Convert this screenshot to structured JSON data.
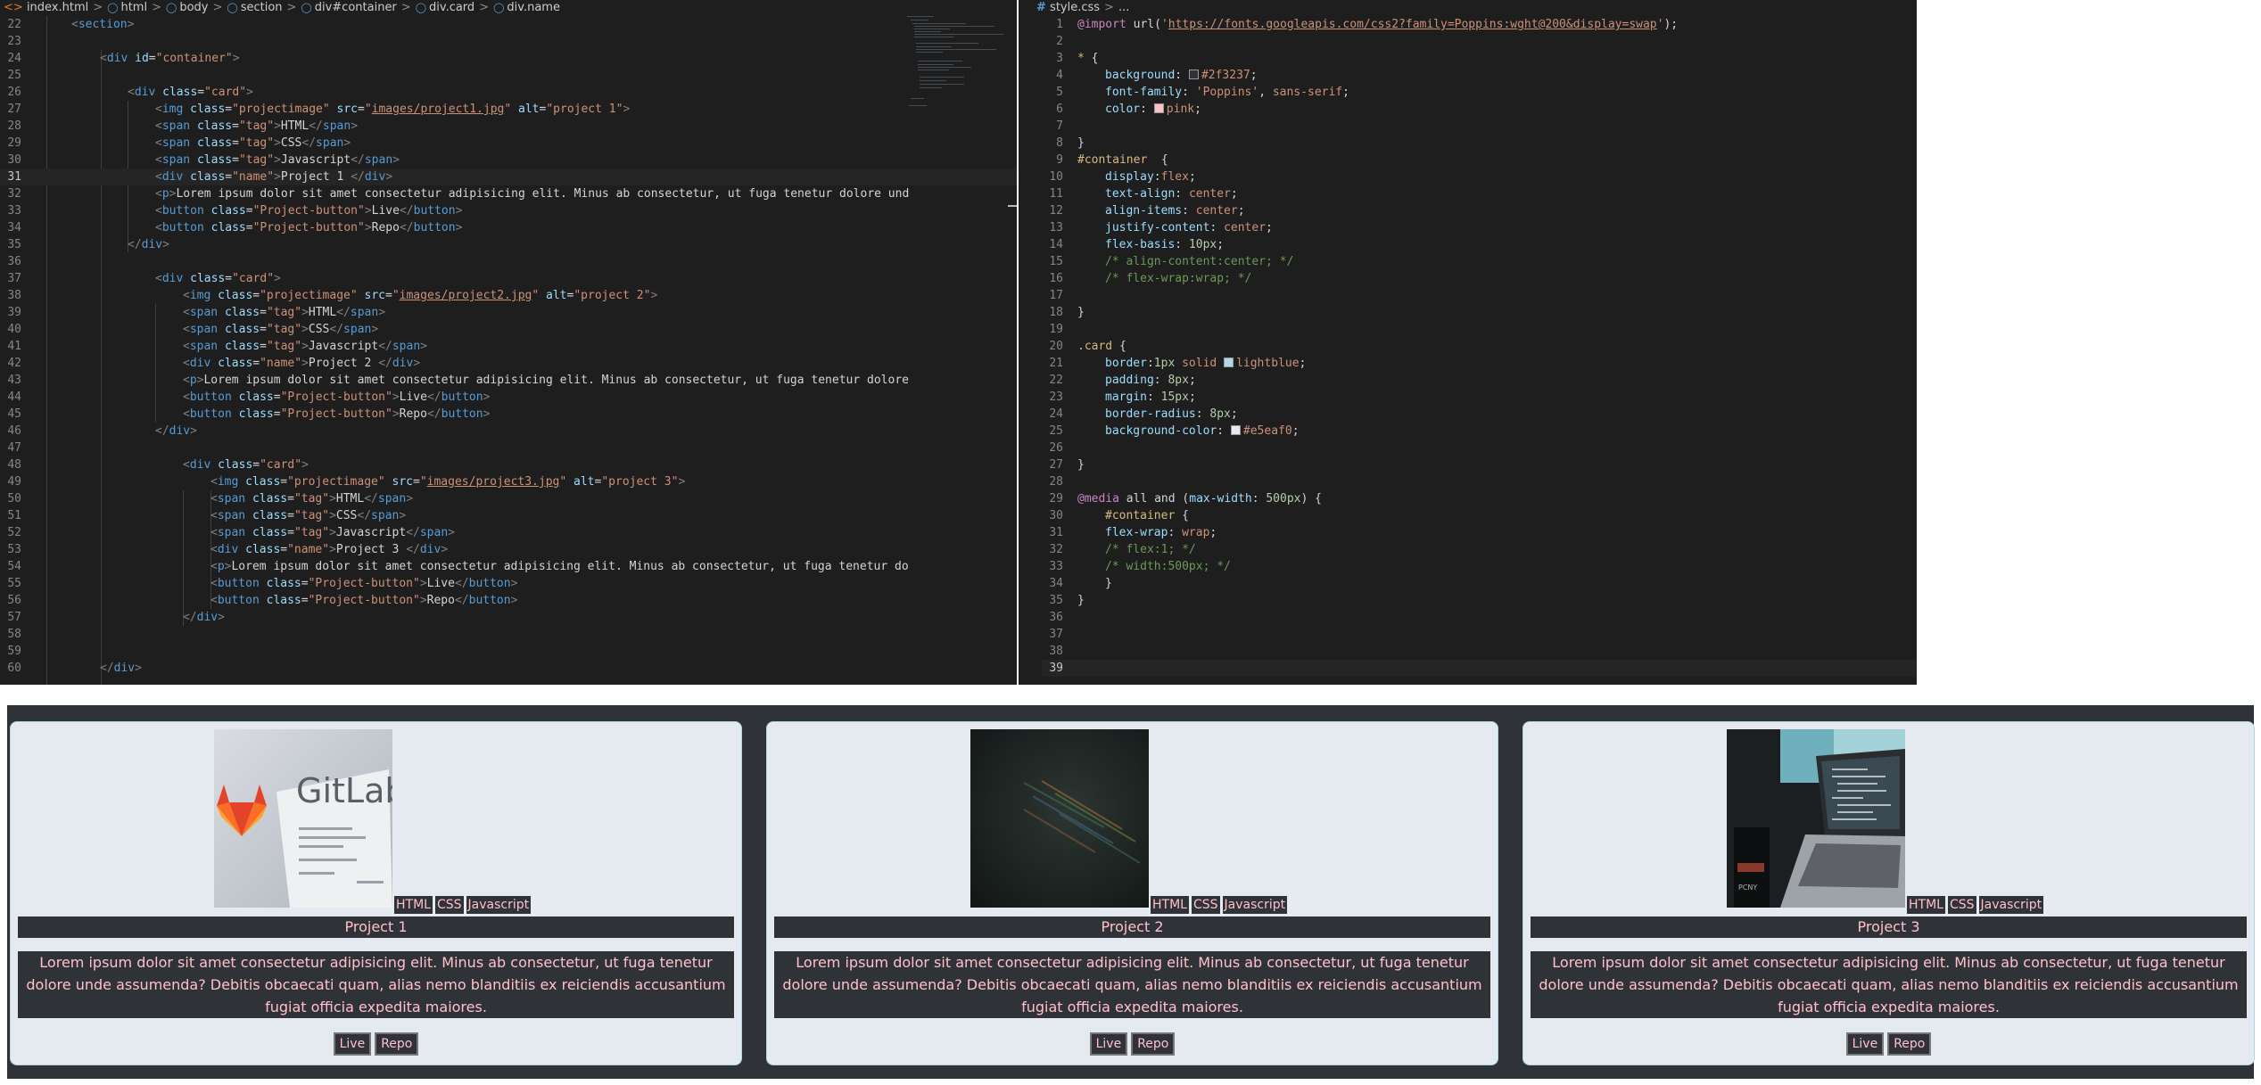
{
  "html_editor": {
    "tab_file": "index.html",
    "breadcrumb": [
      "html",
      "body",
      "section",
      "div#container",
      "div.card",
      "div.name"
    ]
  },
  "css_editor": {
    "tab_file": "style.css",
    "breadcrumb_rest": "..."
  },
  "preview": {
    "cards": [
      {
        "title": "Project 1",
        "tags": [
          "HTML",
          "CSS",
          "Javascript"
        ],
        "image_alt": "GitLab",
        "live": "Live",
        "repo": "Repo",
        "desc": "Lorem ipsum dolor sit amet consectetur adipisicing elit. Minus ab consectetur, ut fuga tenetur dolore unde assumenda? Debitis obcaecati quam, alias nemo blanditiis ex reiciendis accusantium fugiat officia expedita maiores."
      },
      {
        "title": "Project 2",
        "tags": [
          "HTML",
          "CSS",
          "Javascript"
        ],
        "live": "Live",
        "repo": "Repo",
        "desc": "Lorem ipsum dolor sit amet consectetur adipisicing elit. Minus ab consectetur, ut fuga tenetur dolore unde assumenda? Debitis obcaecati quam, alias nemo blanditiis ex reiciendis accusantium fugiat officia expedita maiores."
      },
      {
        "title": "Project 3",
        "tags": [
          "HTML",
          "CSS",
          "Javascript"
        ],
        "live": "Live",
        "repo": "Repo",
        "desc": "Lorem ipsum dolor sit amet consectetur adipisicing elit. Minus ab consectetur, ut fuga tenetur dolore unde assumenda? Debitis obcaecati quam, alias nemo blanditiis ex reiciendis accusantium fugiat officia expedita maiores."
      }
    ]
  },
  "colors": {
    "page_bg": "#2f3237",
    "card_bg": "#e5eaf0",
    "text": "pink",
    "editor_bg": "#1e1e1e"
  }
}
